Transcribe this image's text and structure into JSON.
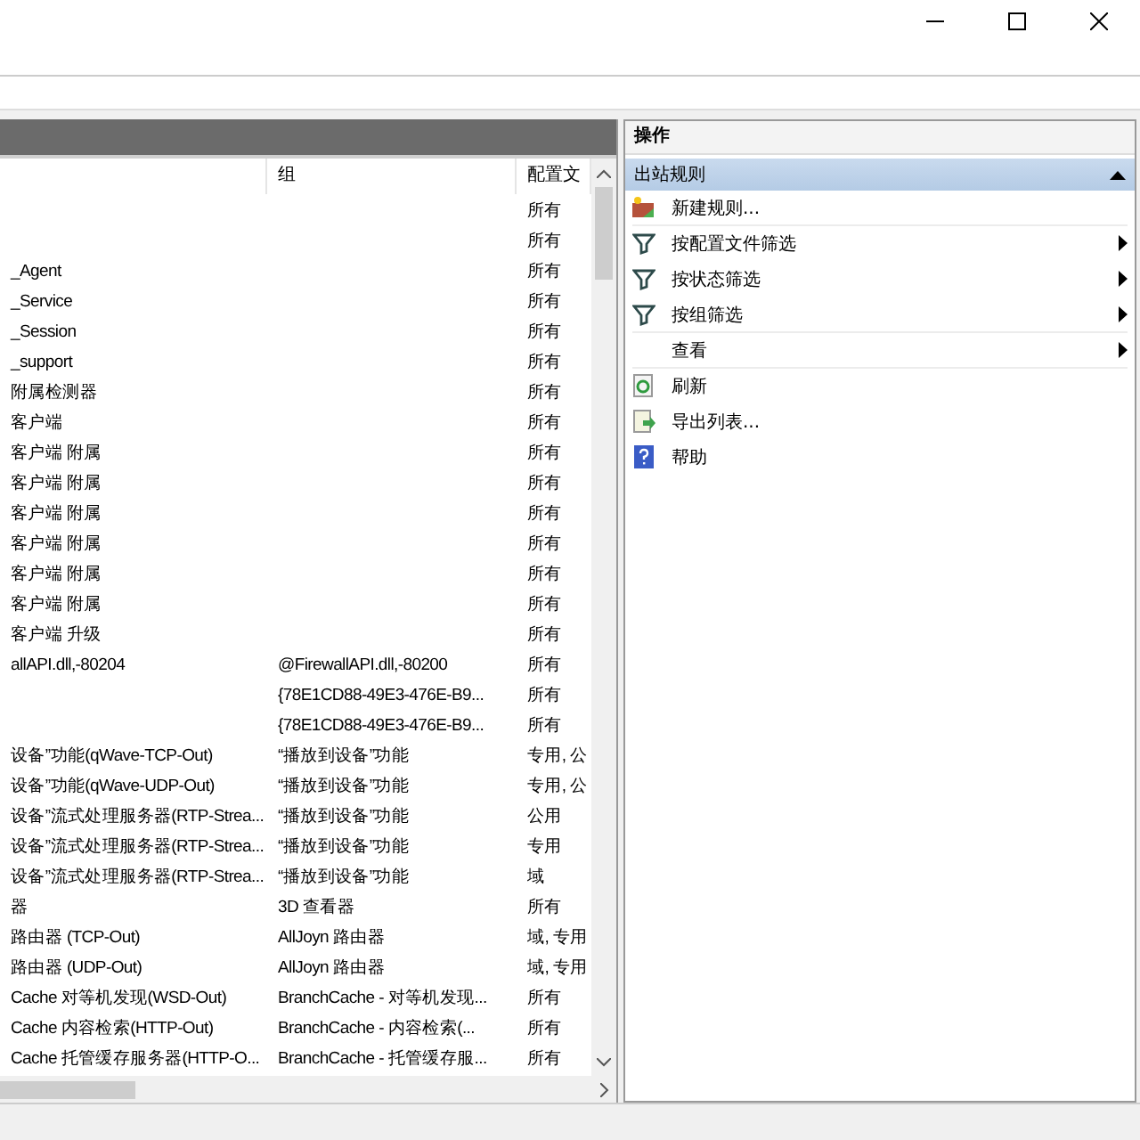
{
  "table": {
    "columns": [
      {},
      {
        "label": "组"
      },
      {
        "label": "配置文"
      }
    ],
    "rows": [
      [
        "",
        "",
        "所有"
      ],
      [
        "",
        "",
        "所有"
      ],
      [
        "_Agent",
        "",
        "所有"
      ],
      [
        "_Service",
        "",
        "所有"
      ],
      [
        "_Session",
        "",
        "所有"
      ],
      [
        "_support",
        "",
        "所有"
      ],
      [
        "附属检测器",
        "",
        "所有"
      ],
      [
        "客户端",
        "",
        "所有"
      ],
      [
        "客户端 附属",
        "",
        "所有"
      ],
      [
        "客户端 附属",
        "",
        "所有"
      ],
      [
        "客户端 附属",
        "",
        "所有"
      ],
      [
        "客户端 附属",
        "",
        "所有"
      ],
      [
        "客户端 附属",
        "",
        "所有"
      ],
      [
        "客户端 附属",
        "",
        "所有"
      ],
      [
        "客户端 升级",
        "",
        "所有"
      ],
      [
        "allAPI.dll,-80204",
        "@FirewallAPI.dll,-80200",
        "所有"
      ],
      [
        "",
        "{78E1CD88-49E3-476E-B9...",
        "所有"
      ],
      [
        "",
        "{78E1CD88-49E3-476E-B9...",
        "所有"
      ],
      [
        "设备”功能(qWave-TCP-Out)",
        "“播放到设备”功能",
        "专用, 公"
      ],
      [
        "设备”功能(qWave-UDP-Out)",
        "“播放到设备”功能",
        "专用, 公"
      ],
      [
        "设备”流式处理服务器(RTP-Strea...",
        "“播放到设备”功能",
        "公用"
      ],
      [
        "设备”流式处理服务器(RTP-Strea...",
        "“播放到设备”功能",
        "专用"
      ],
      [
        "设备”流式处理服务器(RTP-Strea...",
        "“播放到设备”功能",
        "域"
      ],
      [
        "器",
        "3D 查看器",
        "所有"
      ],
      [
        "路由器 (TCP-Out)",
        "AllJoyn 路由器",
        "域, 专用"
      ],
      [
        "路由器 (UDP-Out)",
        "AllJoyn 路由器",
        "域, 专用"
      ],
      [
        "Cache 对等机发现(WSD-Out)",
        "BranchCache - 对等机发现...",
        "所有"
      ],
      [
        "Cache 内容检索(HTTP-Out)",
        "BranchCache - 内容检索(...",
        "所有"
      ],
      [
        "Cache 托管缓存服务器(HTTP-O...",
        "BranchCache - 托管缓存服...",
        "所有"
      ]
    ]
  },
  "actions": {
    "title": "操作",
    "section": {
      "label": "出站规则",
      "expanded": true
    },
    "items": [
      {
        "kind": "new",
        "label": "新建规则...",
        "submenu": false,
        "separator": true
      },
      {
        "kind": "filter",
        "label": "按配置文件筛选",
        "submenu": true,
        "separator": false
      },
      {
        "kind": "filter",
        "label": "按状态筛选",
        "submenu": true,
        "separator": false
      },
      {
        "kind": "filter",
        "label": "按组筛选",
        "submenu": true,
        "separator": true
      },
      {
        "kind": "plain",
        "label": "查看",
        "submenu": true,
        "separator": true
      },
      {
        "kind": "refresh",
        "label": "刷新",
        "submenu": false,
        "separator": false
      },
      {
        "kind": "export",
        "label": "导出列表...",
        "submenu": false,
        "separator": false
      },
      {
        "kind": "help",
        "label": "帮助",
        "submenu": false,
        "separator": false
      }
    ]
  }
}
